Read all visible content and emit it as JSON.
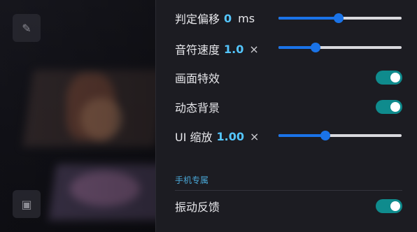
{
  "settings": {
    "judge_offset": {
      "label": "判定偏移",
      "value": "0",
      "unit": "ms",
      "slider_fraction": 0.49
    },
    "note_speed": {
      "label": "音符速度",
      "value": "1.0",
      "unit": "×",
      "slider_fraction": 0.3
    },
    "visual_effects": {
      "label": "画面特效",
      "enabled": true
    },
    "dynamic_background": {
      "label": "动态背景",
      "enabled": true
    },
    "ui_scale": {
      "label": "UI 缩放",
      "value": "1.00",
      "unit": "×",
      "slider_fraction": 0.38
    },
    "mobile_section": {
      "title": "手机专属"
    },
    "vibration_feedback": {
      "label": "振动反馈",
      "enabled": true
    }
  },
  "colors": {
    "accent": "#1a73e8",
    "toggle_on": "#0f8b8d",
    "value_text": "#54c6ff",
    "section_title": "#4aa8d8"
  },
  "icons": {
    "edit": "pencil-icon",
    "shop": "shop-icon"
  }
}
